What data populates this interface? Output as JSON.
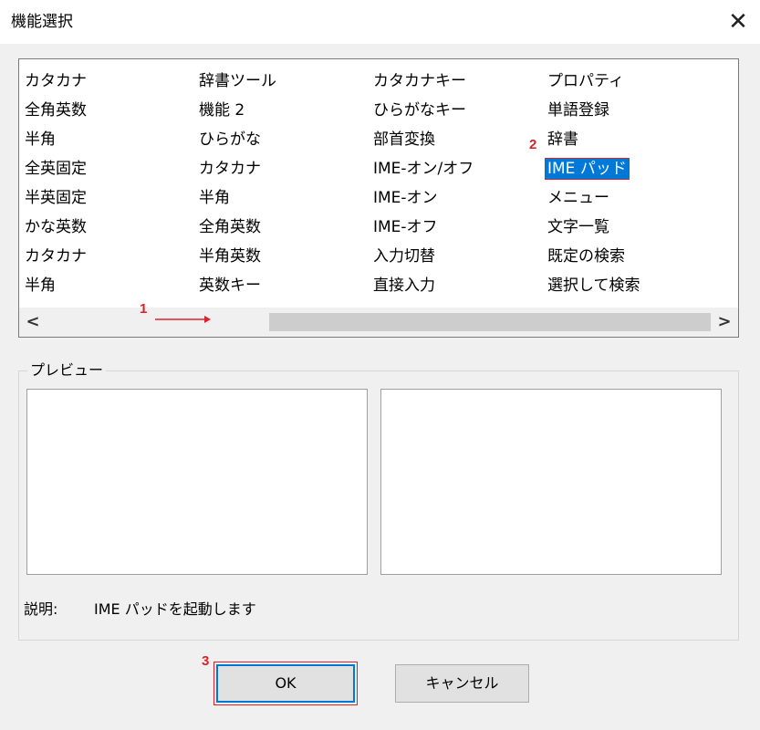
{
  "window": {
    "title": "機能選択",
    "close_glyph": "✕"
  },
  "function_list": {
    "columns": [
      [
        "カタカナ",
        "全角英数",
        "半角",
        "全英固定",
        "半英固定",
        "かな英数",
        "カタカナ",
        "半角"
      ],
      [
        "辞書ツール",
        "機能 2",
        "ひらがな",
        "カタカナ",
        "半角",
        "全角英数",
        "半角英数",
        "英数キー"
      ],
      [
        "カタカナキー",
        "ひらがなキー",
        "部首変換",
        "IME-オン/オフ",
        "IME-オン",
        "IME-オフ",
        "入力切替",
        "直接入力"
      ],
      [
        "プロパティ",
        "単語登録",
        "辞書",
        "IME パッド",
        "メニュー",
        "文字一覧",
        "既定の検索",
        "選択して検索"
      ]
    ],
    "selected": "IME パッド",
    "scroll_left_glyph": "<",
    "scroll_right_glyph": ">"
  },
  "callouts": {
    "one": "1",
    "two": "2",
    "three": "3",
    "color": "#d9222b"
  },
  "preview": {
    "label": "プレビュー"
  },
  "description": {
    "label": "説明:",
    "text": "IME パッドを起動します"
  },
  "buttons": {
    "ok": "OK",
    "cancel": "キャンセル"
  },
  "colors": {
    "selection": "#0078d7",
    "accent": "#0078d7"
  }
}
